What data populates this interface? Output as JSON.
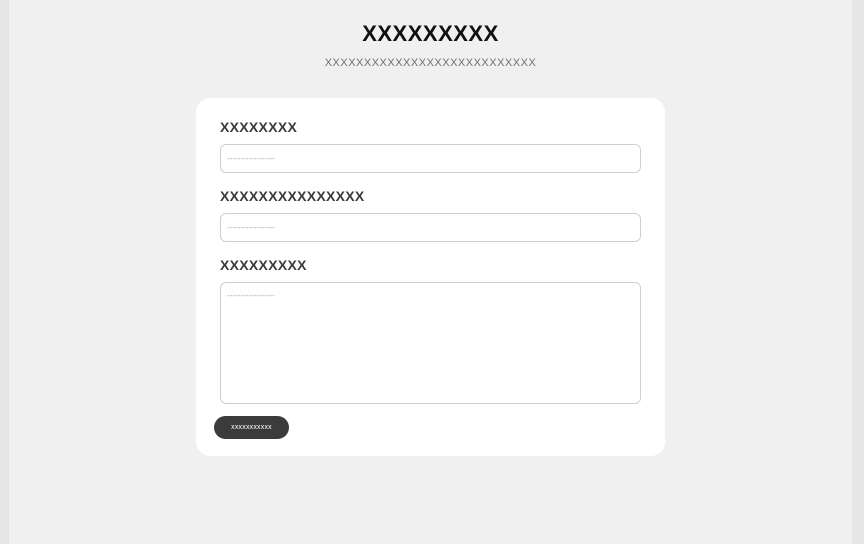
{
  "header": {
    "title": "XXXXXXXXX",
    "subtitle": "XXXXXXXXXXXXXXXXXXXXXXXXXXX"
  },
  "form": {
    "fields": [
      {
        "label": "XXXXXXXX",
        "value": "",
        "placeholder": "------------------"
      },
      {
        "label": "XXXXXXXXXXXXXXX",
        "value": "",
        "placeholder": "------------------"
      },
      {
        "label": "XXXXXXXXX",
        "value": "",
        "placeholder": "------------------"
      }
    ],
    "submit_label": "xxxxxxxxxxx"
  },
  "colors": {
    "background": "#f0f0f0",
    "card": "#ffffff",
    "button": "#3b3b3b",
    "button_text": "#ffffff"
  }
}
